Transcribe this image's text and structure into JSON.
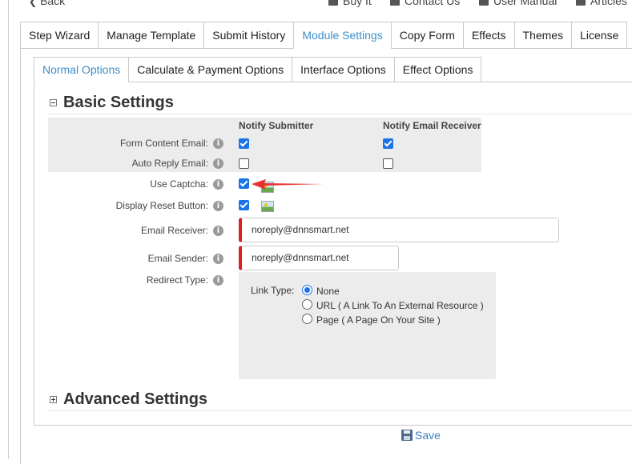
{
  "top_links": [
    {
      "label": "Back",
      "icon": "chevron-left-icon"
    },
    {
      "label": "Buy It",
      "icon": "cart-icon"
    },
    {
      "label": "Contact Us",
      "icon": "envelope-icon"
    },
    {
      "label": "User Manual",
      "icon": "book-icon"
    },
    {
      "label": "Articles",
      "icon": "document-icon"
    }
  ],
  "main_tabs": [
    {
      "label": "Step Wizard"
    },
    {
      "label": "Manage Template"
    },
    {
      "label": "Submit History"
    },
    {
      "label": "Module Settings",
      "active": true
    },
    {
      "label": "Copy Form"
    },
    {
      "label": "Effects"
    },
    {
      "label": "Themes"
    },
    {
      "label": "License"
    }
  ],
  "sub_tabs": [
    {
      "label": "Normal Options",
      "active": true
    },
    {
      "label": "Calculate & Payment Options"
    },
    {
      "label": "Interface Options"
    },
    {
      "label": "Effect Options"
    }
  ],
  "basic_settings": {
    "title": "Basic Settings",
    "col_notify_submitter": "Notify Submitter",
    "col_notify_receiver": "Notify Email Receiver",
    "form_content_email": {
      "label": "Form Content Email:",
      "submitter": true,
      "receiver": true
    },
    "auto_reply_email": {
      "label": "Auto Reply Email:",
      "submitter": false,
      "receiver": false
    },
    "use_captcha": {
      "label": "Use Captcha:",
      "checked": true
    },
    "display_reset_button": {
      "label": "Display Reset Button:",
      "checked": true
    },
    "email_receiver": {
      "label": "Email Receiver:",
      "value": "noreply@dnnsmart.net"
    },
    "email_sender": {
      "label": "Email Sender:",
      "value": "noreply@dnnsmart.net"
    },
    "redirect_type": {
      "label": "Redirect Type:",
      "link_type_label": "Link Type:",
      "options": [
        {
          "label": "None",
          "selected": true
        },
        {
          "label": "URL ( A Link To An External Resource )",
          "selected": false
        },
        {
          "label": "Page ( A Page On Your Site )",
          "selected": false
        }
      ]
    }
  },
  "advanced_settings": {
    "title": "Advanced Settings"
  },
  "save_label": "Save",
  "colors": {
    "accent": "#3c8dcc",
    "required_marker": "#e02020",
    "arrow": "#e53030"
  }
}
